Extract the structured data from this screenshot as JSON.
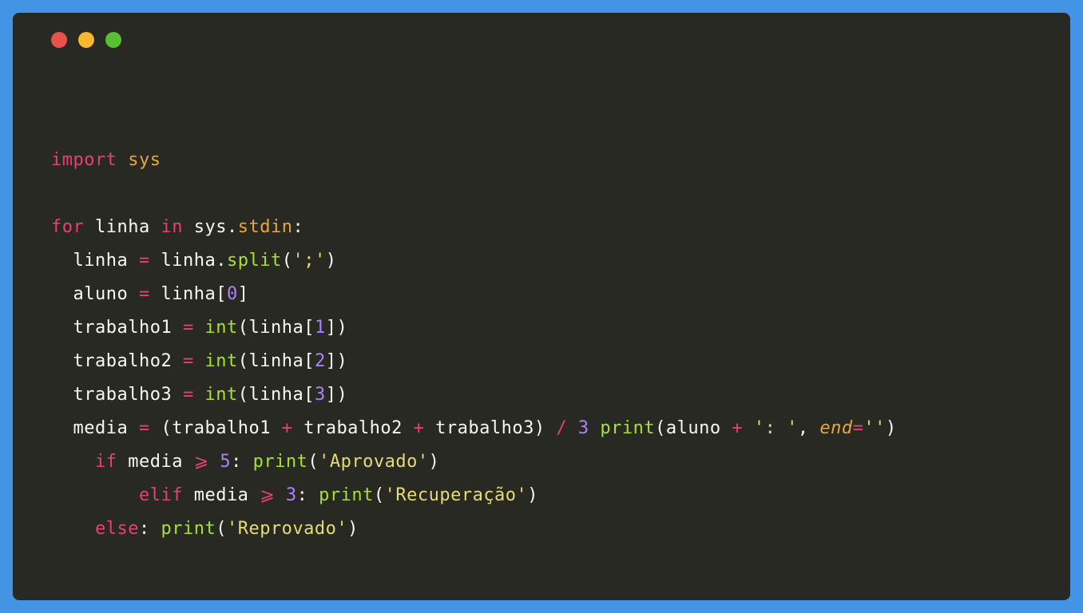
{
  "window": {
    "traffic_lights": [
      "close",
      "minimize",
      "zoom"
    ]
  },
  "code": {
    "lines": [
      [
        {
          "cls": "kw",
          "t": "import"
        },
        {
          "cls": "punct",
          "t": " "
        },
        {
          "cls": "mod",
          "t": "sys"
        }
      ],
      [],
      [
        {
          "cls": "kw",
          "t": "for"
        },
        {
          "cls": "punct",
          "t": " "
        },
        {
          "cls": "ident",
          "t": "linha"
        },
        {
          "cls": "punct",
          "t": " "
        },
        {
          "cls": "kw",
          "t": "in"
        },
        {
          "cls": "punct",
          "t": " "
        },
        {
          "cls": "ident",
          "t": "sys"
        },
        {
          "cls": "punct",
          "t": "."
        },
        {
          "cls": "mod",
          "t": "stdin"
        },
        {
          "cls": "punct",
          "t": ":"
        }
      ],
      [
        {
          "cls": "punct",
          "t": "  "
        },
        {
          "cls": "ident",
          "t": "linha"
        },
        {
          "cls": "punct",
          "t": " "
        },
        {
          "cls": "op",
          "t": "="
        },
        {
          "cls": "punct",
          "t": " "
        },
        {
          "cls": "ident",
          "t": "linha"
        },
        {
          "cls": "punct",
          "t": "."
        },
        {
          "cls": "func",
          "t": "split"
        },
        {
          "cls": "punct",
          "t": "("
        },
        {
          "cls": "str",
          "t": "';'"
        },
        {
          "cls": "punct",
          "t": ")"
        }
      ],
      [
        {
          "cls": "punct",
          "t": "  "
        },
        {
          "cls": "ident",
          "t": "aluno"
        },
        {
          "cls": "punct",
          "t": " "
        },
        {
          "cls": "op",
          "t": "="
        },
        {
          "cls": "punct",
          "t": " "
        },
        {
          "cls": "ident",
          "t": "linha"
        },
        {
          "cls": "punct",
          "t": "["
        },
        {
          "cls": "num",
          "t": "0"
        },
        {
          "cls": "punct",
          "t": "]"
        }
      ],
      [
        {
          "cls": "punct",
          "t": "  "
        },
        {
          "cls": "ident",
          "t": "trabalho1"
        },
        {
          "cls": "punct",
          "t": " "
        },
        {
          "cls": "op",
          "t": "="
        },
        {
          "cls": "punct",
          "t": " "
        },
        {
          "cls": "func",
          "t": "int"
        },
        {
          "cls": "punct",
          "t": "("
        },
        {
          "cls": "ident",
          "t": "linha"
        },
        {
          "cls": "punct",
          "t": "["
        },
        {
          "cls": "num",
          "t": "1"
        },
        {
          "cls": "punct",
          "t": "])"
        }
      ],
      [
        {
          "cls": "punct",
          "t": "  "
        },
        {
          "cls": "ident",
          "t": "trabalho2"
        },
        {
          "cls": "punct",
          "t": " "
        },
        {
          "cls": "op",
          "t": "="
        },
        {
          "cls": "punct",
          "t": " "
        },
        {
          "cls": "func",
          "t": "int"
        },
        {
          "cls": "punct",
          "t": "("
        },
        {
          "cls": "ident",
          "t": "linha"
        },
        {
          "cls": "punct",
          "t": "["
        },
        {
          "cls": "num",
          "t": "2"
        },
        {
          "cls": "punct",
          "t": "])"
        }
      ],
      [
        {
          "cls": "punct",
          "t": "  "
        },
        {
          "cls": "ident",
          "t": "trabalho3"
        },
        {
          "cls": "punct",
          "t": " "
        },
        {
          "cls": "op",
          "t": "="
        },
        {
          "cls": "punct",
          "t": " "
        },
        {
          "cls": "func",
          "t": "int"
        },
        {
          "cls": "punct",
          "t": "("
        },
        {
          "cls": "ident",
          "t": "linha"
        },
        {
          "cls": "punct",
          "t": "["
        },
        {
          "cls": "num",
          "t": "3"
        },
        {
          "cls": "punct",
          "t": "])"
        }
      ],
      [
        {
          "cls": "punct",
          "t": "  "
        },
        {
          "cls": "ident",
          "t": "media"
        },
        {
          "cls": "punct",
          "t": " "
        },
        {
          "cls": "op",
          "t": "="
        },
        {
          "cls": "punct",
          "t": " ("
        },
        {
          "cls": "ident",
          "t": "trabalho1"
        },
        {
          "cls": "punct",
          "t": " "
        },
        {
          "cls": "op",
          "t": "+"
        },
        {
          "cls": "punct",
          "t": " "
        },
        {
          "cls": "ident",
          "t": "trabalho2"
        },
        {
          "cls": "punct",
          "t": " "
        },
        {
          "cls": "op",
          "t": "+"
        },
        {
          "cls": "punct",
          "t": " "
        },
        {
          "cls": "ident",
          "t": "trabalho3"
        },
        {
          "cls": "punct",
          "t": ") "
        },
        {
          "cls": "op",
          "t": "/"
        },
        {
          "cls": "punct",
          "t": " "
        },
        {
          "cls": "num",
          "t": "3"
        },
        {
          "cls": "punct",
          "t": " "
        },
        {
          "cls": "func",
          "t": "print"
        },
        {
          "cls": "punct",
          "t": "("
        },
        {
          "cls": "ident",
          "t": "aluno"
        },
        {
          "cls": "punct",
          "t": " "
        },
        {
          "cls": "op",
          "t": "+"
        },
        {
          "cls": "punct",
          "t": " "
        },
        {
          "cls": "str",
          "t": "': '"
        },
        {
          "cls": "punct",
          "t": ", "
        },
        {
          "cls": "param",
          "t": "end"
        },
        {
          "cls": "op",
          "t": "="
        },
        {
          "cls": "str",
          "t": "''"
        },
        {
          "cls": "punct",
          "t": ")"
        }
      ],
      [
        {
          "cls": "punct",
          "t": "    "
        },
        {
          "cls": "kw",
          "t": "if"
        },
        {
          "cls": "punct",
          "t": " "
        },
        {
          "cls": "ident",
          "t": "media"
        },
        {
          "cls": "punct",
          "t": " "
        },
        {
          "cls": "op",
          "t": "⩾"
        },
        {
          "cls": "punct",
          "t": " "
        },
        {
          "cls": "num",
          "t": "5"
        },
        {
          "cls": "punct",
          "t": ": "
        },
        {
          "cls": "func",
          "t": "print"
        },
        {
          "cls": "punct",
          "t": "("
        },
        {
          "cls": "str",
          "t": "'Aprovado'"
        },
        {
          "cls": "punct",
          "t": ")"
        }
      ],
      [
        {
          "cls": "punct",
          "t": "        "
        },
        {
          "cls": "kw",
          "t": "elif"
        },
        {
          "cls": "punct",
          "t": " "
        },
        {
          "cls": "ident",
          "t": "media"
        },
        {
          "cls": "punct",
          "t": " "
        },
        {
          "cls": "op",
          "t": "⩾"
        },
        {
          "cls": "punct",
          "t": " "
        },
        {
          "cls": "num",
          "t": "3"
        },
        {
          "cls": "punct",
          "t": ": "
        },
        {
          "cls": "func",
          "t": "print"
        },
        {
          "cls": "punct",
          "t": "("
        },
        {
          "cls": "str",
          "t": "'Recuperação'"
        },
        {
          "cls": "punct",
          "t": ")"
        }
      ],
      [
        {
          "cls": "punct",
          "t": "    "
        },
        {
          "cls": "kw",
          "t": "else"
        },
        {
          "cls": "punct",
          "t": ": "
        },
        {
          "cls": "func",
          "t": "print"
        },
        {
          "cls": "punct",
          "t": "("
        },
        {
          "cls": "str",
          "t": "'Reprovado'"
        },
        {
          "cls": "punct",
          "t": ")"
        }
      ]
    ]
  }
}
